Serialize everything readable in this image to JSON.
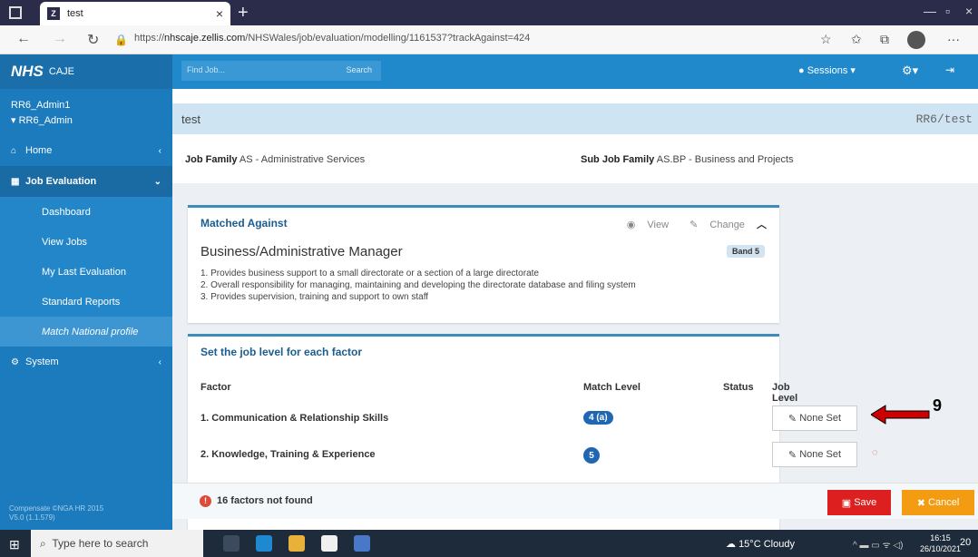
{
  "browser": {
    "tab_title": "test",
    "tab_favicon": "Z",
    "url_prefix": "https://",
    "url_domain": "nhscaje.zellis.com",
    "url_path": "/NHSWales/job/evaluation/modelling/1161537?trackAgainst=424"
  },
  "sidebar": {
    "logo_nhs": "NHS",
    "logo_caje": "CAJE",
    "user_name": "RR6_Admin1",
    "user_role": "▾ RR6_Admin",
    "home": "Home",
    "job_evaluation": "Job Evaluation",
    "sub_items": [
      "Dashboard",
      "View Jobs",
      "My Last Evaluation",
      "Standard Reports",
      "Match National profile"
    ],
    "system": "System",
    "footer_line1": "Compensate ©NGA HR 2015",
    "footer_line2": "V5.0 (1.1.579)"
  },
  "topnav": {
    "find_placeholder": "Find Job...",
    "search_label": "Search",
    "sessions": "Sessions ▾"
  },
  "job": {
    "title": "test",
    "code": "RR6/test",
    "family_label": "Job Family",
    "family_value": "AS - Administrative Services",
    "sub_family_label": "Sub Job Family",
    "sub_family_value": "AS.BP - Business and Projects"
  },
  "matched": {
    "heading": "Matched Against",
    "view": "View",
    "change": "Change",
    "profile_name": "Business/Administrative Manager",
    "band": "Band 5",
    "points": [
      "1. Provides business support to a small directorate or a section of a large directorate",
      "2. Overall responsibility for managing, maintaining and developing the directorate database and filing system",
      "3. Provides supervision, training and support to own staff"
    ]
  },
  "levels": {
    "heading": "Set the job level for each factor",
    "col_factor": "Factor",
    "col_match": "Match Level",
    "col_status": "Status",
    "col_job_level": "Job Level",
    "rows": [
      {
        "factor": "1. Communication & Relationship Skills",
        "match": "4 (a)",
        "job_level": "None Set"
      },
      {
        "factor": "2. Knowledge, Training & Experience",
        "match": "5",
        "job_level": "None Set"
      }
    ]
  },
  "annotation": {
    "number": "9",
    "color": "#cc0000"
  },
  "footer": {
    "warning": "16 factors not found",
    "save": "Save",
    "cancel": "Cancel"
  },
  "taskbar": {
    "search_placeholder": "Type here to search",
    "weather": "15°C Cloudy",
    "time": "16:15",
    "date": "26/10/2021",
    "notify_count": "20"
  },
  "colors": {
    "sidebar": "#1b7bbd",
    "topnav": "#2089cc",
    "save": "#dd1f1f",
    "cancel": "#f39c12"
  }
}
